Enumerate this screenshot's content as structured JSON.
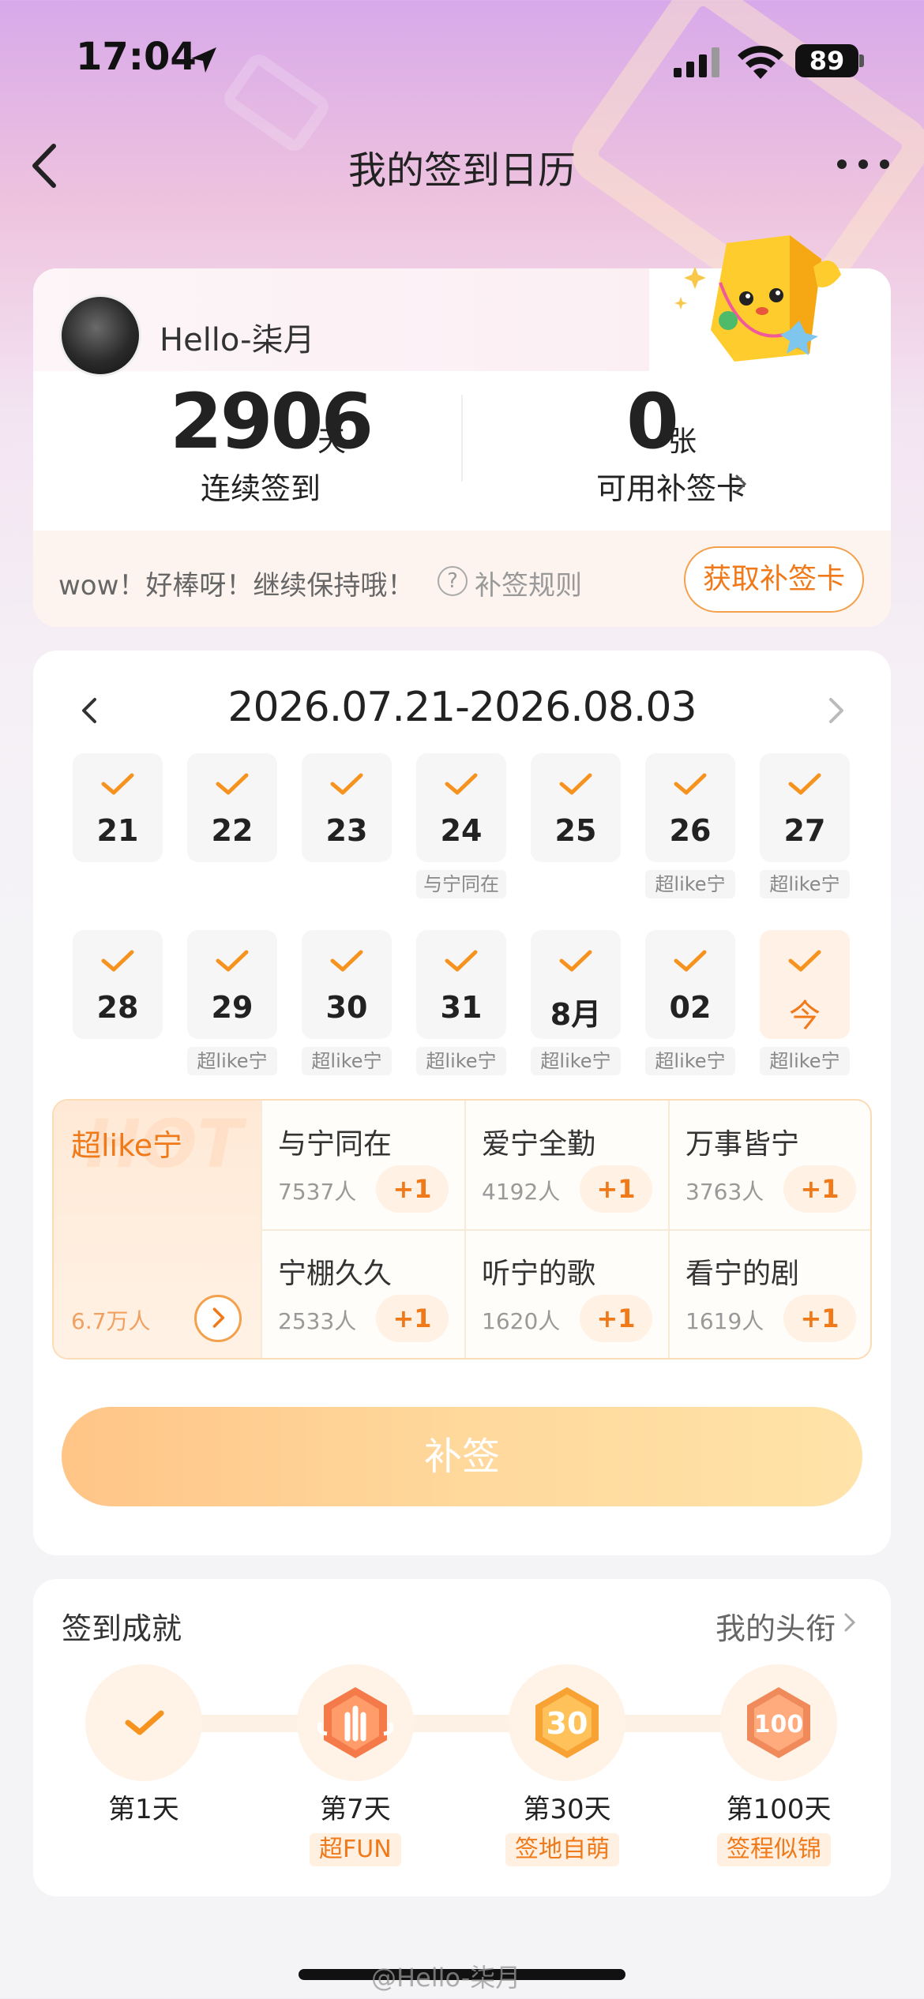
{
  "status_bar": {
    "time": "17:04",
    "battery": "89"
  },
  "nav": {
    "title": "我的签到日历"
  },
  "profile": {
    "username": "Hello-柒月",
    "streak_value": "2906",
    "streak_unit": "天",
    "streak_label": "连续签到",
    "cards_value": "0",
    "cards_unit": "张",
    "cards_label": "可用补签卡",
    "encourage": "wow！好棒呀！继续保持哦！",
    "rule_icon_glyph": "?",
    "rule_label": "补签规则",
    "get_card_label": "获取补签卡"
  },
  "calendar": {
    "range": "2026.07.21-2026.08.03",
    "week1": [
      {
        "num": "21",
        "tag": ""
      },
      {
        "num": "22",
        "tag": ""
      },
      {
        "num": "23",
        "tag": ""
      },
      {
        "num": "24",
        "tag": "与宁同在"
      },
      {
        "num": "25",
        "tag": ""
      },
      {
        "num": "26",
        "tag": "超like宁"
      },
      {
        "num": "27",
        "tag": "超like宁"
      }
    ],
    "week2": [
      {
        "num": "28",
        "tag": ""
      },
      {
        "num": "29",
        "tag": "超like宁"
      },
      {
        "num": "30",
        "tag": "超like宁"
      },
      {
        "num": "31",
        "tag": "超like宁"
      },
      {
        "num": "8月",
        "tag": "超like宁"
      },
      {
        "num": "02",
        "tag": "超like宁"
      },
      {
        "num": "今",
        "tag": "超like宁"
      }
    ]
  },
  "topics": {
    "hot_watermark": "HOT",
    "featured": {
      "name": "超like宁",
      "count": "6.7万人"
    },
    "items": [
      {
        "name": "与宁同在",
        "count": "7537人",
        "plus": "+1"
      },
      {
        "name": "爱宁全勤",
        "count": "4192人",
        "plus": "+1"
      },
      {
        "name": "万事皆宁",
        "count": "3763人",
        "plus": "+1"
      },
      {
        "name": "宁棚久久",
        "count": "2533人",
        "plus": "+1"
      },
      {
        "name": "听宁的歌",
        "count": "1620人",
        "plus": "+1"
      },
      {
        "name": "看宁的剧",
        "count": "1619人",
        "plus": "+1"
      }
    ]
  },
  "supplement_label": "补签",
  "achievements": {
    "title": "签到成就",
    "link": "我的头衔",
    "items": [
      {
        "day": "第1天",
        "badge": ""
      },
      {
        "day": "第7天",
        "badge": "超FUN"
      },
      {
        "day": "第30天",
        "badge": "签地自萌"
      },
      {
        "day": "第100天",
        "badge": "签程似锦"
      }
    ]
  },
  "watermark": "@Hello-柒月",
  "colors": {
    "accent": "#f07a1a",
    "check": "#f5931e",
    "button_gradient_start": "#ffc587",
    "button_gradient_end": "#ffe3a8"
  }
}
